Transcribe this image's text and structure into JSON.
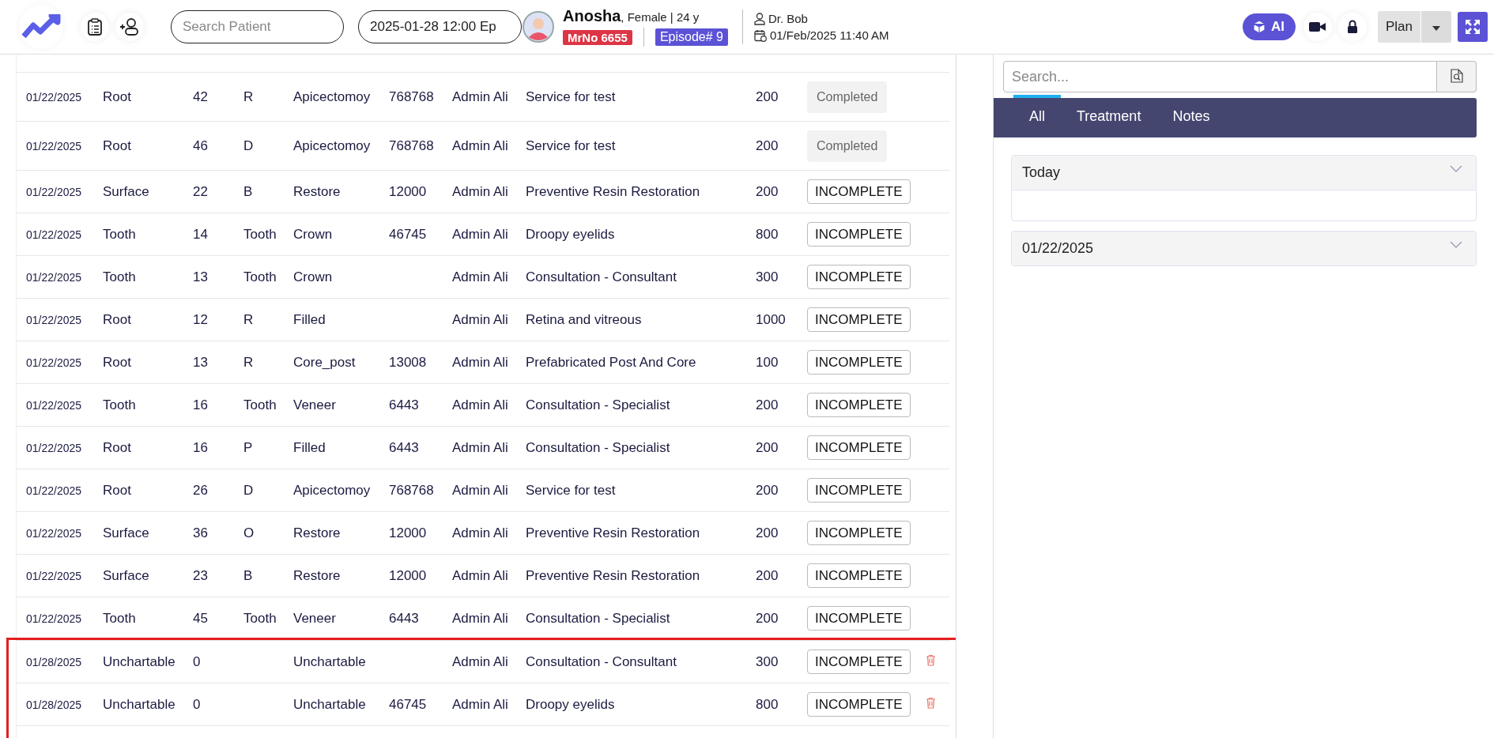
{
  "header": {
    "search_patient": {
      "placeholder": "Search Patient"
    },
    "episode_select": {
      "value": "2025-01-28 12:00 Ep"
    },
    "patient": {
      "name": "Anosha",
      "details": ", Female | 24 y",
      "mrno": "MrNo 6655",
      "episode": "Episode# 9"
    },
    "doctor": "Dr. Bob",
    "datetime": "01/Feb/2025 11:40 AM",
    "ai_button": "AI",
    "plan_button": "Plan"
  },
  "rows": [
    {
      "date": "01/22/2025",
      "type": "Root",
      "tooth": "42",
      "surface": "R",
      "procedure": "Apicectomoy",
      "code": "768768",
      "provider": "Admin Ali",
      "service": "Service for test",
      "amount": "200",
      "status": {
        "kind": "completed",
        "label": "Completed"
      },
      "deletable": false,
      "highlighted": false
    },
    {
      "date": "01/22/2025",
      "type": "Root",
      "tooth": "46",
      "surface": "D",
      "procedure": "Apicectomoy",
      "code": "768768",
      "provider": "Admin Ali",
      "service": "Service for test",
      "amount": "200",
      "status": {
        "kind": "completed",
        "label": "Completed"
      },
      "deletable": false,
      "highlighted": false
    },
    {
      "date": "01/22/2025",
      "type": "Surface",
      "tooth": "22",
      "surface": "B",
      "procedure": "Restore",
      "code": "12000",
      "provider": "Admin Ali",
      "service": "Preventive Resin Restoration",
      "amount": "200",
      "status": {
        "kind": "incomplete",
        "label": "INCOMPLETE"
      },
      "deletable": false,
      "highlighted": false
    },
    {
      "date": "01/22/2025",
      "type": "Tooth",
      "tooth": "14",
      "surface": "Tooth",
      "procedure": "Crown",
      "code": "46745",
      "provider": "Admin Ali",
      "service": "Droopy eyelids",
      "amount": "800",
      "status": {
        "kind": "incomplete",
        "label": "INCOMPLETE"
      },
      "deletable": false,
      "highlighted": false
    },
    {
      "date": "01/22/2025",
      "type": "Tooth",
      "tooth": "13",
      "surface": "Tooth",
      "procedure": "Crown",
      "code": "",
      "provider": "Admin Ali",
      "service": "Consultation - Consultant",
      "amount": "300",
      "status": {
        "kind": "incomplete",
        "label": "INCOMPLETE"
      },
      "deletable": false,
      "highlighted": false
    },
    {
      "date": "01/22/2025",
      "type": "Root",
      "tooth": "12",
      "surface": "R",
      "procedure": "Filled",
      "code": "",
      "provider": "Admin Ali",
      "service": "Retina and vitreous",
      "amount": "1000",
      "status": {
        "kind": "incomplete",
        "label": "INCOMPLETE"
      },
      "deletable": false,
      "highlighted": false
    },
    {
      "date": "01/22/2025",
      "type": "Root",
      "tooth": "13",
      "surface": "R",
      "procedure": "Core_post",
      "code": "13008",
      "provider": "Admin Ali",
      "service": "Prefabricated Post And Core",
      "amount": "100",
      "status": {
        "kind": "incomplete",
        "label": "INCOMPLETE"
      },
      "deletable": false,
      "highlighted": false
    },
    {
      "date": "01/22/2025",
      "type": "Tooth",
      "tooth": "16",
      "surface": "Tooth",
      "procedure": "Veneer",
      "code": "6443",
      "provider": "Admin Ali",
      "service": "Consultation - Specialist",
      "amount": "200",
      "status": {
        "kind": "incomplete",
        "label": "INCOMPLETE"
      },
      "deletable": false,
      "highlighted": false
    },
    {
      "date": "01/22/2025",
      "type": "Root",
      "tooth": "16",
      "surface": "P",
      "procedure": "Filled",
      "code": "6443",
      "provider": "Admin Ali",
      "service": "Consultation - Specialist",
      "amount": "200",
      "status": {
        "kind": "incomplete",
        "label": "INCOMPLETE"
      },
      "deletable": false,
      "highlighted": false
    },
    {
      "date": "01/22/2025",
      "type": "Root",
      "tooth": "26",
      "surface": "D",
      "procedure": "Apicectomoy",
      "code": "768768",
      "provider": "Admin Ali",
      "service": "Service for test",
      "amount": "200",
      "status": {
        "kind": "incomplete",
        "label": "INCOMPLETE"
      },
      "deletable": false,
      "highlighted": false
    },
    {
      "date": "01/22/2025",
      "type": "Surface",
      "tooth": "36",
      "surface": "O",
      "procedure": "Restore",
      "code": "12000",
      "provider": "Admin Ali",
      "service": "Preventive Resin Restoration",
      "amount": "200",
      "status": {
        "kind": "incomplete",
        "label": "INCOMPLETE"
      },
      "deletable": false,
      "highlighted": false
    },
    {
      "date": "01/22/2025",
      "type": "Surface",
      "tooth": "23",
      "surface": "B",
      "procedure": "Restore",
      "code": "12000",
      "provider": "Admin Ali",
      "service": "Preventive Resin Restoration",
      "amount": "200",
      "status": {
        "kind": "incomplete",
        "label": "INCOMPLETE"
      },
      "deletable": false,
      "highlighted": false
    },
    {
      "date": "01/22/2025",
      "type": "Tooth",
      "tooth": "45",
      "surface": "Tooth",
      "procedure": "Veneer",
      "code": "6443",
      "provider": "Admin Ali",
      "service": "Consultation - Specialist",
      "amount": "200",
      "status": {
        "kind": "incomplete",
        "label": "INCOMPLETE"
      },
      "deletable": false,
      "highlighted": false
    },
    {
      "date": "01/28/2025",
      "type": "Unchartable",
      "tooth": "0",
      "surface": "",
      "procedure": "Unchartable",
      "code": "",
      "provider": "Admin Ali",
      "service": "Consultation - Consultant",
      "amount": "300",
      "status": {
        "kind": "incomplete",
        "label": "INCOMPLETE"
      },
      "deletable": true,
      "highlighted": true
    },
    {
      "date": "01/28/2025",
      "type": "Unchartable",
      "tooth": "0",
      "surface": "",
      "procedure": "Unchartable",
      "code": "46745",
      "provider": "Admin Ali",
      "service": "Droopy eyelids",
      "amount": "800",
      "status": {
        "kind": "incomplete",
        "label": "INCOMPLETE"
      },
      "deletable": true,
      "highlighted": true
    }
  ],
  "side_panel": {
    "search": {
      "placeholder": "Search..."
    },
    "tabs": [
      {
        "label": "All",
        "selected": true
      },
      {
        "label": "Treatment",
        "selected": false
      },
      {
        "label": "Notes",
        "selected": false
      }
    ],
    "sections": [
      {
        "title": "Today",
        "expanded": true
      },
      {
        "title": "01/22/2025",
        "expanded": false
      }
    ]
  }
}
